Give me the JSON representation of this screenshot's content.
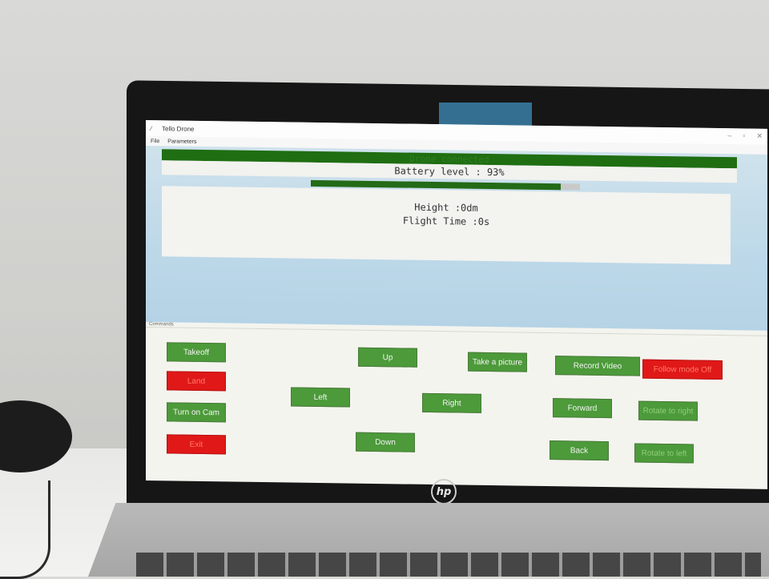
{
  "window": {
    "title": "Tello Drone",
    "menu": [
      "File",
      "Parameters"
    ]
  },
  "status": {
    "connection": "Drone connected",
    "battery_text": "Battery level : 93%",
    "battery_percent": 93,
    "height_text": "Height :0dm",
    "flight_time_text": "Flight Time :0s"
  },
  "commands": {
    "section_label": "Commands",
    "takeoff": "Takeoff",
    "land": "Land",
    "turn_on_cam": "Turn on Cam",
    "exit": "Exit",
    "up": "Up",
    "left": "Left",
    "right": "Right",
    "down": "Down",
    "take_picture": "Take a picture",
    "record_video": "Record Video",
    "follow_mode": "Follow mode Off",
    "forward": "Forward",
    "back": "Back",
    "rotate_right": "Rotate to right",
    "rotate_left": "Rotate to left"
  },
  "laptop": {
    "brand": "hp"
  },
  "colors": {
    "button_green": "#4c9a3a",
    "button_red": "#e01818",
    "status_green": "#1f6e12"
  }
}
